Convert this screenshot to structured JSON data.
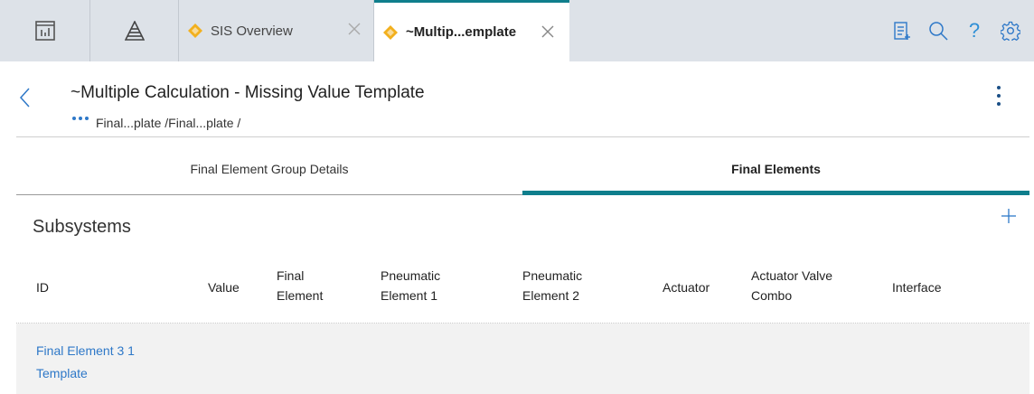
{
  "tabs": {
    "icons": [
      "dashboard-icon",
      "pyramid-icon"
    ],
    "documents": [
      {
        "label": "SIS Overview",
        "active": false
      },
      {
        "label": "~Multip...emplate",
        "active": true
      }
    ],
    "tools": [
      "clipboard-list-icon",
      "search-icon",
      "help-icon",
      "gear-icon"
    ],
    "help_glyph": "?"
  },
  "header": {
    "title": "~Multiple Calculation - Missing Value Template",
    "breadcrumb": "Final...plate /Final...plate /"
  },
  "section_tabs": [
    {
      "label": "Final Element Group Details",
      "active": false
    },
    {
      "label": "Final Elements",
      "active": true
    }
  ],
  "subsystems": {
    "title": "Subsystems",
    "columns": {
      "id": "ID",
      "value": "Value",
      "final_element": [
        "Final",
        "Element"
      ],
      "pneumatic_1": [
        "Pneumatic",
        "Element 1"
      ],
      "pneumatic_2": [
        "Pneumatic",
        "Element 2"
      ],
      "actuator": "Actuator",
      "actuator_valve": [
        "Actuator Valve",
        "Combo"
      ],
      "interface": "Interface"
    },
    "rows": [
      {
        "id": [
          "Final Element 3 1",
          "Template"
        ]
      }
    ]
  },
  "colors": {
    "accent": "#0f7e8c",
    "link": "#2e78c8",
    "diamond": "#f2b01e",
    "tabbar": "#dde2e8"
  }
}
